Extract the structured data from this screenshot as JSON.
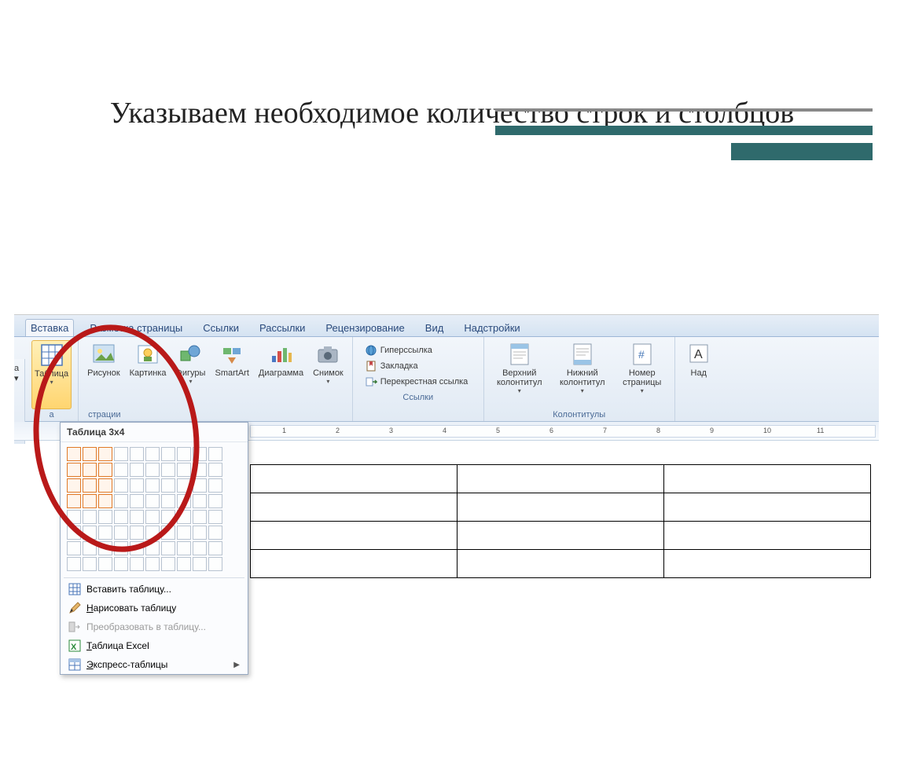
{
  "slide_title": "Указываем необходимое количество строк и столбцов",
  "ribbon": {
    "tabs": {
      "active": "Вставка",
      "list": [
        "Разметка страницы",
        "Ссылки",
        "Рассылки",
        "Рецензирование",
        "Вид",
        "Надстройки"
      ]
    },
    "groups": {
      "tables_label_partial": "а",
      "table_btn": "Таблица",
      "illustr_partial": "страции",
      "illustrations": [
        "Рисунок",
        "Картинка",
        "Фигуры",
        "SmartArt",
        "Диаграмма",
        "Снимок"
      ],
      "links_label": "Ссылки",
      "links": {
        "hyperlink": "Гиперссылка",
        "bookmark": "Закладка",
        "crossref": "Перекрестная ссылка"
      },
      "header_footer_label": "Колонтитулы",
      "header_footer": {
        "header": "Верхний колонтитул",
        "footer": "Нижний колонтитул",
        "pagenum": "Номер страницы"
      },
      "text_partial": "Над"
    }
  },
  "dropdown": {
    "title": "Таблица 3x4",
    "grid_cols": 10,
    "grid_rows": 8,
    "sel_cols": 3,
    "sel_rows": 4,
    "items": {
      "insert": "Вставить таблицу...",
      "draw": "Нарисовать таблицу",
      "convert": "Преобразовать в таблицу...",
      "excel": "Таблица Excel",
      "express": "Экспресс-таблицы"
    }
  },
  "ruler_numbers": [
    1,
    2,
    3,
    4,
    5,
    6,
    7,
    8,
    9,
    10,
    11
  ],
  "left_edge_text": "а ▾"
}
